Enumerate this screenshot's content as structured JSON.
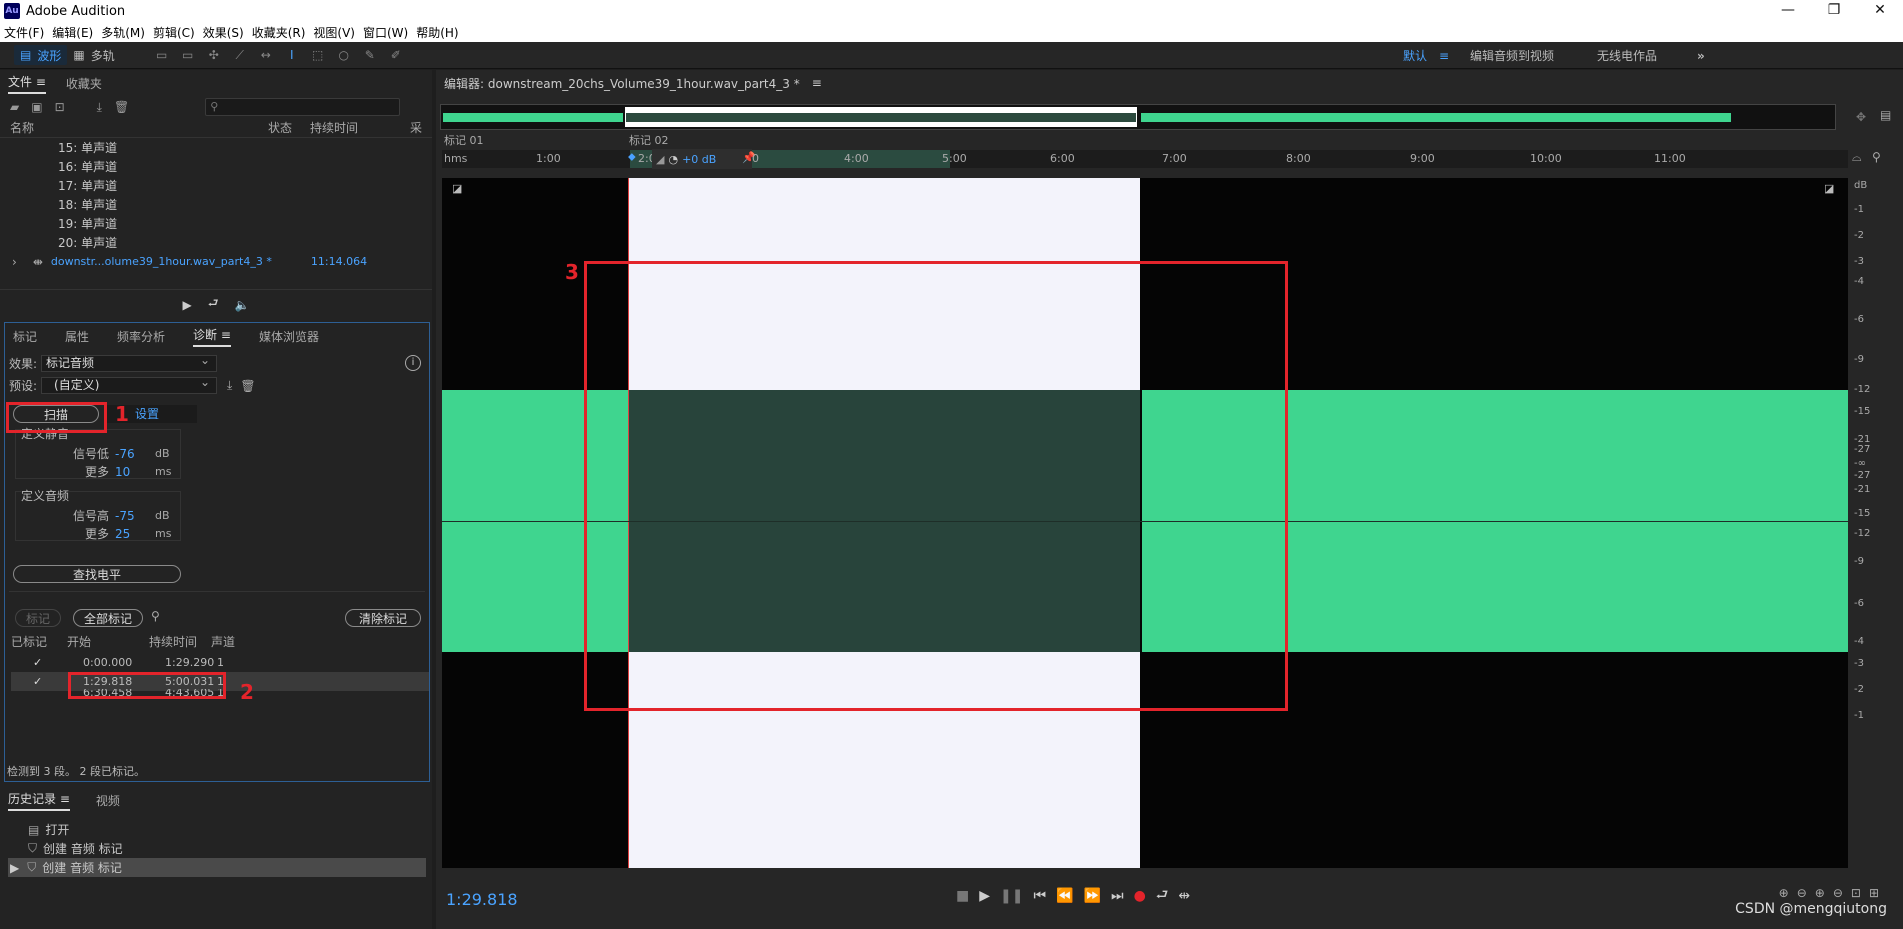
{
  "app": {
    "title": "Adobe Audition",
    "logo": "Au"
  },
  "window_controls": {
    "minimize": "—",
    "maximize": "❐",
    "close": "✕"
  },
  "menu": [
    "文件(F)",
    "编辑(E)",
    "多轨(M)",
    "剪辑(C)",
    "效果(S)",
    "收藏夹(R)",
    "视图(V)",
    "窗口(W)",
    "帮助(H)"
  ],
  "toolbar": {
    "waveform": "波形",
    "multitrack": "多轨"
  },
  "workspace": {
    "default": "默认",
    "edit_video": "编辑音频到视频",
    "wireless": "无线电作品",
    "more": "»"
  },
  "files_panel": {
    "tabs": [
      "文件",
      "收藏夹"
    ],
    "columns": {
      "name": "名称",
      "status": "状态",
      "duration": "持续时间",
      "sample": "采"
    },
    "channels": [
      "15: 单声道",
      "16: 单声道",
      "17: 单声道",
      "18: 单声道",
      "19: 单声道",
      "20: 单声道"
    ],
    "file": {
      "name": "downstr...olume39_1hour.wav_part4_3 *",
      "duration": "11:14.064"
    }
  },
  "diagnostics": {
    "tabs": [
      "标记",
      "属性",
      "频率分析",
      "诊断",
      "媒体浏览器"
    ],
    "effect_label": "效果:",
    "effect_value": "标记音频",
    "preset_label": "预设:",
    "preset_value": "(自定义)",
    "scan_button": "扫描",
    "settings_tab": "设置",
    "silence_group": "定义静音",
    "silence_signal_label": "信号低",
    "silence_signal_value": "-76",
    "silence_signal_unit": "dB",
    "silence_more_label": "更多",
    "silence_more_value": "10",
    "silence_more_unit": "ms",
    "audio_group": "定义音频",
    "audio_signal_label": "信号高",
    "audio_signal_value": "-75",
    "audio_signal_unit": "dB",
    "audio_more_label": "更多",
    "audio_more_value": "25",
    "audio_more_unit": "ms",
    "find_levels": "查找电平",
    "mark_button": "标记",
    "mark_all": "全部标记",
    "clear_marks": "清除标记",
    "table_headers": {
      "marked": "已标记",
      "start": "开始",
      "duration": "持续时间",
      "channel": "声道"
    },
    "rows": [
      {
        "marked": "✓",
        "start": "0:00.000",
        "duration": "1:29.290",
        "channel": "1"
      },
      {
        "marked": "✓",
        "start": "1:29.818",
        "duration": "5:00.031",
        "channel": "1"
      },
      {
        "marked": "",
        "start": "6:30.458",
        "duration": "4:43.605",
        "channel": "1"
      }
    ],
    "status": "检测到 3 段。 2 段已标记。"
  },
  "history": {
    "tabs": [
      "历史记录",
      "视频"
    ],
    "items": [
      "打开",
      "创建 音频 标记",
      "创建 音频 标记"
    ]
  },
  "editor": {
    "title": "编辑器: downstream_20chs_Volume39_1hour.wav_part4_3 *",
    "markers": [
      "标记 01",
      "标记 02"
    ],
    "ruler_labels": [
      "hms",
      "1:00",
      "2:0",
      "0",
      "4:00",
      "5:00",
      "6:00",
      "7:00",
      "8:00",
      "9:00",
      "10:00",
      "11:00"
    ],
    "volume": "+0 dB",
    "db_labels": [
      "dB",
      "-1",
      "-2",
      "-3",
      "-4",
      "-6",
      "-9",
      "-12",
      "-15",
      "-21",
      "-27",
      "-∞",
      "-27",
      "-21",
      "-15",
      "-12",
      "-9",
      "-6",
      "-4",
      "-3",
      "-2",
      "-1"
    ],
    "timecode": "1:29.818"
  },
  "annotations": [
    "1",
    "2",
    "3"
  ],
  "watermark": "CSDN @mengqiutong",
  "colors": {
    "accent": "#4aa3ff",
    "wave": "#3fd58f",
    "selection": "#f3f3fb",
    "annotation": "#e3242b"
  }
}
